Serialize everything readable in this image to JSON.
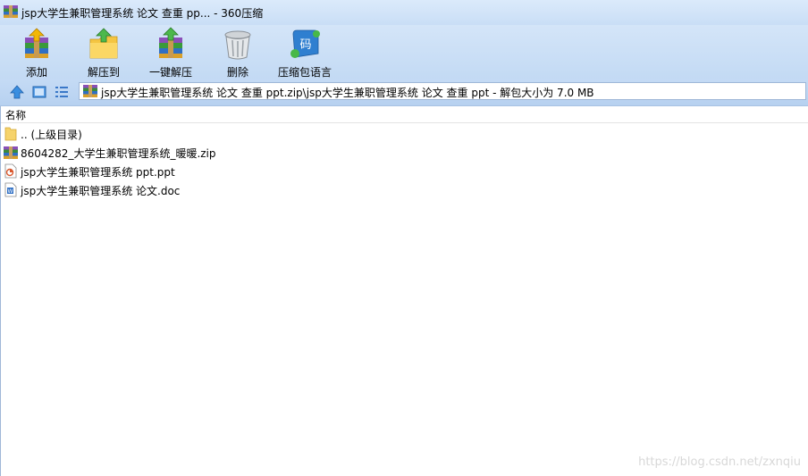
{
  "window": {
    "title": "jsp大学生兼职管理系统 论文 查重 pp... - 360压缩"
  },
  "toolbar": {
    "buttons": [
      {
        "label": "添加",
        "icon": "add-archive-icon"
      },
      {
        "label": "解压到",
        "icon": "extract-to-icon"
      },
      {
        "label": "一键解压",
        "icon": "one-click-extract-icon"
      },
      {
        "label": "删除",
        "icon": "trash-icon"
      },
      {
        "label": "压缩包语言",
        "icon": "archive-language-icon"
      }
    ]
  },
  "nav": {
    "up_icon": "up-arrow-icon",
    "view_icon": "thumbnail-view-icon",
    "list_icon": "list-view-icon"
  },
  "address": {
    "path": "jsp大学生兼职管理系统 论文 查重 ppt.zip\\jsp大学生兼职管理系统 论文 查重 ppt - 解包大小为 7.0 MB"
  },
  "columns": {
    "name": "名称"
  },
  "files": [
    {
      "name": ".. (上级目录)",
      "icon": "folder-icon"
    },
    {
      "name": "8604282_大学生兼职管理系统_暖暖.zip",
      "icon": "zip-file-icon"
    },
    {
      "name": "jsp大学生兼职管理系统 ppt.ppt",
      "icon": "ppt-file-icon"
    },
    {
      "name": "jsp大学生兼职管理系统 论文.doc",
      "icon": "doc-file-icon"
    }
  ],
  "watermark": "https://blog.csdn.net/zxnqiu",
  "colors": {
    "titlebar": "#dbeafb",
    "toolbar": "#c9def6",
    "accent": "#3a78c8"
  }
}
